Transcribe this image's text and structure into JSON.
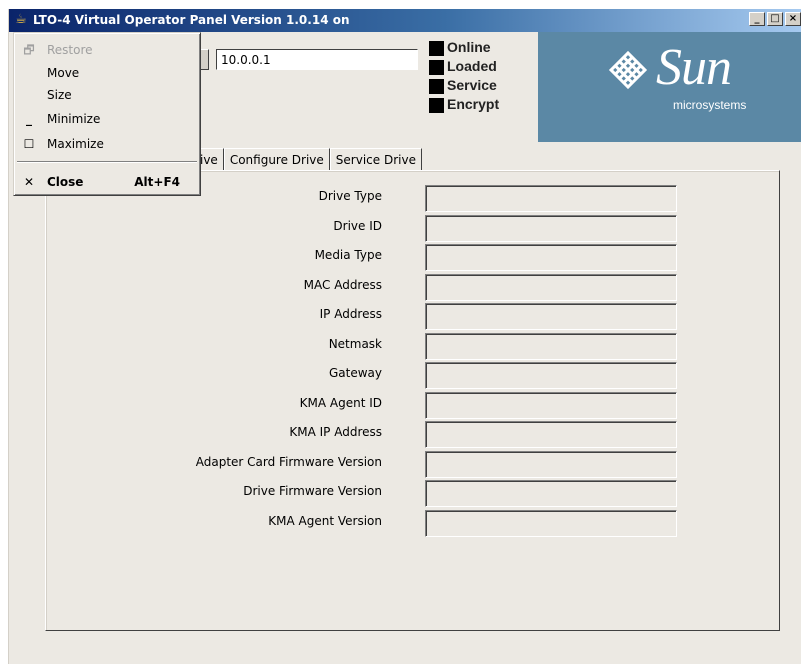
{
  "window": {
    "title": "LTO-4 Virtual Operator Panel Version 1.0.14 on",
    "app_icon": "java-cup-icon",
    "controls": {
      "minimize": "_",
      "restore": "□",
      "close": "×"
    }
  },
  "connection": {
    "address_value": "10.0.0.1"
  },
  "status_indicators": [
    {
      "label": "Online"
    },
    {
      "label": "Loaded"
    },
    {
      "label": "Service"
    },
    {
      "label": "Encrypt"
    }
  ],
  "logo": {
    "word": "Sun",
    "sub": "microsystems",
    "color": "#5b88a5"
  },
  "tabs": [
    {
      "label": "ive"
    },
    {
      "label": "Configure Drive"
    },
    {
      "label": "Service Drive"
    }
  ],
  "fields": [
    {
      "label": "Drive Type",
      "value": ""
    },
    {
      "label": "Drive ID",
      "value": ""
    },
    {
      "label": "Media Type",
      "value": ""
    },
    {
      "label": "MAC Address",
      "value": ""
    },
    {
      "label": "IP Address",
      "value": ""
    },
    {
      "label": "Netmask",
      "value": ""
    },
    {
      "label": "Gateway",
      "value": ""
    },
    {
      "label": "KMA Agent ID",
      "value": ""
    },
    {
      "label": "KMA IP Address",
      "value": ""
    },
    {
      "label": "Adapter Card Firmware Version",
      "value": ""
    },
    {
      "label": "Drive Firmware Version",
      "value": ""
    },
    {
      "label": "KMA Agent Version",
      "value": ""
    }
  ],
  "system_menu": {
    "items": [
      {
        "label": "Restore",
        "icon": "restore-icon",
        "glyph": "🗗",
        "disabled": true
      },
      {
        "label": "Move",
        "icon": "",
        "glyph": "",
        "disabled": false
      },
      {
        "label": "Size",
        "icon": "",
        "glyph": "",
        "disabled": false
      },
      {
        "label": "Minimize",
        "icon": "minimize-icon",
        "glyph": "_",
        "disabled": false
      },
      {
        "label": "Maximize",
        "icon": "maximize-icon",
        "glyph": "☐",
        "disabled": false
      },
      {
        "label": "Close",
        "icon": "close-icon",
        "glyph": "✕",
        "disabled": false,
        "shortcut": "Alt+F4"
      }
    ]
  }
}
